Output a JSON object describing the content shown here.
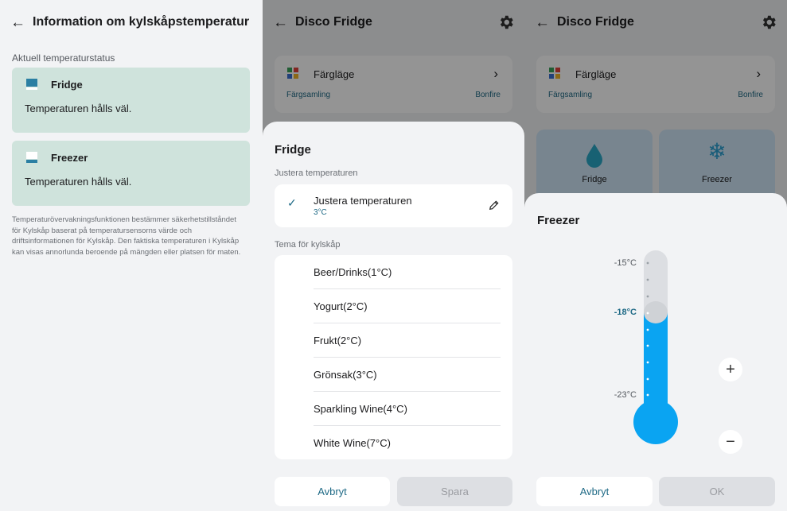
{
  "panel1": {
    "title": "Information om kylskåpstemperatur",
    "section_label": "Aktuell temperaturstatus",
    "cards": [
      {
        "name": "Fridge",
        "status": "Temperaturen hålls väl."
      },
      {
        "name": "Freezer",
        "status": "Temperaturen hålls väl."
      }
    ],
    "note": "Temperaturövervakningsfunktionen bestämmer säkerhetstillståndet för Kylskåp baserat på temperatursensorns värde och driftsinformationen för Kylskåp. Den faktiska temperaturen i Kylskåp kan visas annorlunda beroende på mängden eller platsen för maten."
  },
  "panel2": {
    "title": "Disco Fridge",
    "color_mode": {
      "label": "Färgläge",
      "sub_left": "Färgsamling",
      "sub_right": "Bonfire"
    },
    "sheet": {
      "title": "Fridge",
      "adjust_label": "Justera temperaturen",
      "adjust_item_title": "Justera temperaturen",
      "adjust_item_value": "3°C",
      "theme_label": "Tema för kylskåp",
      "themes": [
        "Beer/Drinks(1°C)",
        "Yogurt(2°C)",
        "Frukt(2°C)",
        "Grönsak(3°C)",
        "Sparkling Wine(4°C)",
        "White Wine(7°C)"
      ],
      "cancel": "Avbryt",
      "save": "Spara"
    }
  },
  "panel3": {
    "title": "Disco Fridge",
    "color_mode": {
      "label": "Färgläge",
      "sub_left": "Färgsamling",
      "sub_right": "Bonfire"
    },
    "tiles": [
      {
        "label": "Fridge"
      },
      {
        "label": "Freezer"
      }
    ],
    "sheet": {
      "title": "Freezer",
      "scale_top": "-15°C",
      "scale_current": "-18°C",
      "scale_bottom": "-23°C",
      "temperature_level": -18,
      "temperature_range": [
        -23,
        -15
      ],
      "cancel": "Avbryt",
      "ok": "OK"
    }
  },
  "colors": {
    "accent": "#1f6a86",
    "status_card": "#cfe3dc",
    "thermo_fill": "#0aa4f2",
    "thermo_track": "#dcdee2"
  }
}
